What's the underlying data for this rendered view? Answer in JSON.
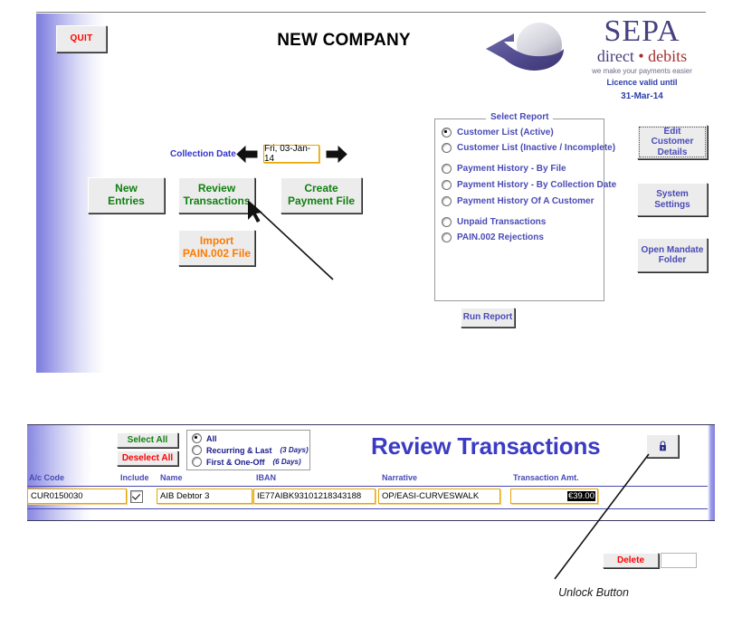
{
  "main_panel": {
    "quit_label": "QUIT",
    "company_title": "NEW COMPANY",
    "logo": {
      "main": "SEPA",
      "sub_left": "direct",
      "sub_dot": "•",
      "sub_right": "debits",
      "tagline": "we make your payments easier",
      "licence_label": "Licence valid until",
      "licence_date": "31-Mar-14"
    },
    "collection": {
      "label": "Collection Date",
      "date_value": "Fri, 03-Jan-14",
      "prev_icon": "left-arrow-icon",
      "next_icon": "right-arrow-icon"
    },
    "buttons": {
      "new_entries": "New\nEntries",
      "new_entries_l1": "New",
      "new_entries_l2": "Entries",
      "review_l1": "Review",
      "review_l2": "Transactions",
      "create_l1": "Create",
      "create_l2": "Payment File",
      "import_l1": "Import",
      "import_l2": "PAIN.002 File",
      "edit_customer_l1": "Edit",
      "edit_customer_l2": "Customer",
      "edit_customer_l3": "Details",
      "system_settings_l1": "System",
      "system_settings_l2": "Settings",
      "open_mandate_l1": "Open Mandate",
      "open_mandate_l2": "Folder",
      "run_report": "Run Report"
    },
    "select_report": {
      "legend": "Select Report",
      "options": [
        {
          "label": "Customer List (Active)",
          "selected": true
        },
        {
          "label": "Customer List (Inactive / Incomplete)",
          "selected": false
        },
        {
          "label": "Payment History - By File",
          "selected": false
        },
        {
          "label": "Payment History - By Collection Date",
          "selected": false
        },
        {
          "label": "Payment History Of A Customer",
          "selected": false
        },
        {
          "label": "Unpaid Transactions",
          "selected": false
        },
        {
          "label": "PAIN.002 Rejections",
          "selected": false
        }
      ]
    }
  },
  "review_panel": {
    "title": "Review Transactions",
    "select_all": "Select All",
    "deselect_all": "Deselect All",
    "unlock_icon": "lock-icon",
    "filters": [
      {
        "label": "All",
        "days": "",
        "selected": true
      },
      {
        "label": "Recurring & Last",
        "days": "(3 Days)",
        "selected": false
      },
      {
        "label": "First & One-Off",
        "days": "(6 Days)",
        "selected": false
      }
    ],
    "table": {
      "headers": [
        "A/c Code",
        "Include",
        "Name",
        "IBAN",
        "Narrative",
        "Transaction Amt."
      ],
      "rows": [
        {
          "ac_code": "CUR0150030",
          "include": true,
          "name": "AIB Debtor 3",
          "iban": "IE77AIBK93101218343188",
          "narrative": "OP/EASI-CURVESWALK",
          "amount": "€39.00",
          "delete_label": "Delete"
        }
      ]
    }
  },
  "annotations": {
    "unlock_caption": "Unlock Button"
  },
  "colors": {
    "accent_blue": "#3b3bc4",
    "label_blue": "#4a4ab5",
    "green": "#108110",
    "red": "#ff0000",
    "orange": "#ff7a00",
    "field_border": "#e5a705"
  }
}
